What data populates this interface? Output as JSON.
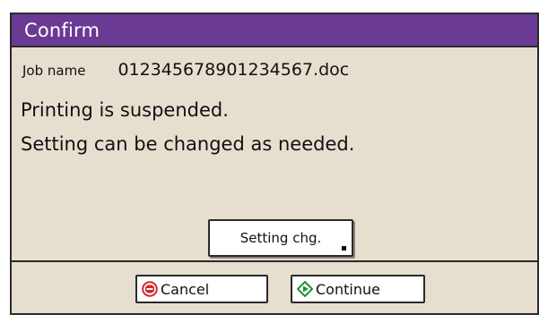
{
  "dialog": {
    "title": "Confirm",
    "job_label": "Job name",
    "job_value": "012345678901234567.doc",
    "message_line1": "Printing is suspended.",
    "message_line2": "Setting can be changed as needed.",
    "setting_button_label": "Setting chg."
  },
  "footer": {
    "cancel_label": "Cancel",
    "continue_label": "Continue",
    "cancel_icon": "stop-circle-icon",
    "continue_icon": "start-diamond-icon"
  },
  "colors": {
    "titlebar": "#6a3a95",
    "background": "#e6dfd0",
    "cancel_icon": "#d6262b",
    "continue_icon": "#1f8f3a"
  }
}
